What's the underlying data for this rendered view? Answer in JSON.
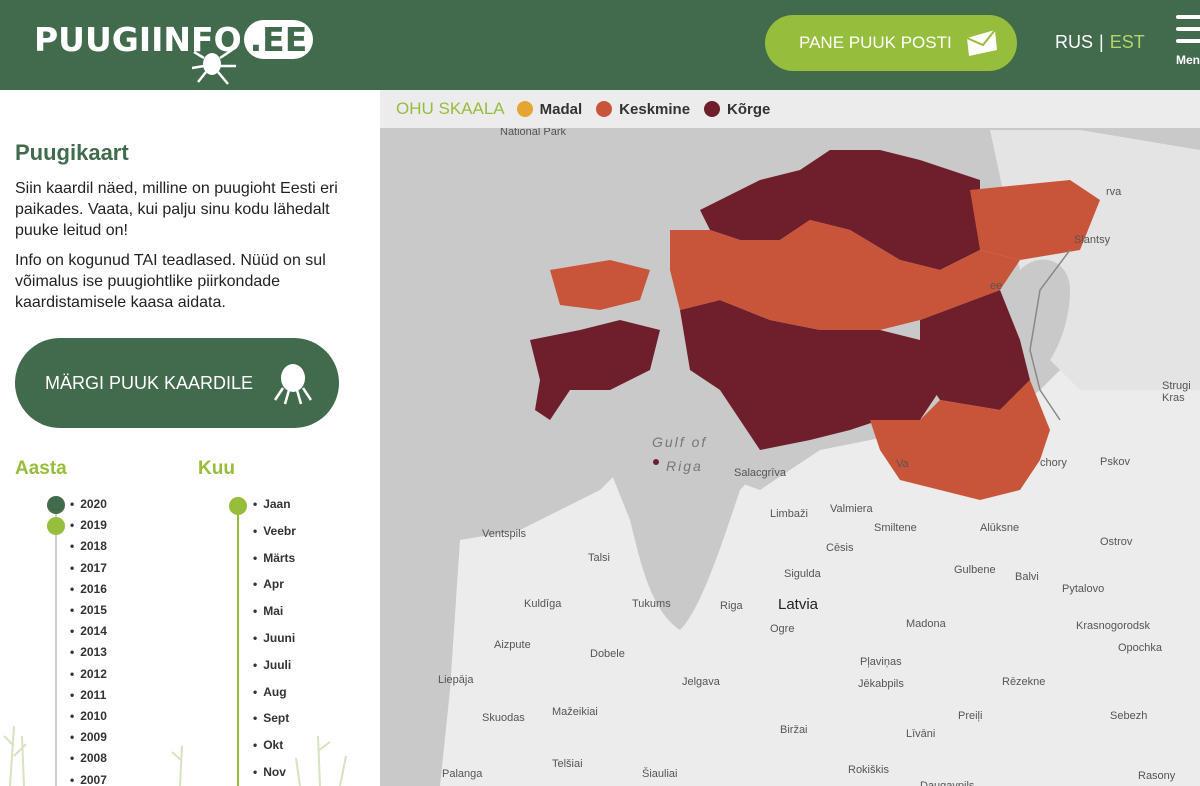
{
  "header": {
    "logo_text": "PUUGIINFO",
    "logo_ee": ".EE",
    "post_button": "PANE PUUK POSTI",
    "lang_rus": "RUS",
    "lang_sep": "|",
    "lang_est": "EST",
    "menu_label": "Menu"
  },
  "sidebar": {
    "title": "Puugikaart",
    "description_1": "Siin kaardil näed, milline on puugioht Eesti eri paikades. Vaata, kui palju sinu kodu lähedalt puuke leitud on!",
    "description_2": "Info on kogunud TAI teadlased. Nüüd on sul võimalus ise puugiohtlike piirkondade kaardistamisele kaasa aidata.",
    "mark_button": "MÄRGI PUUK KAARDILE",
    "year_title": "Aasta",
    "month_title": "Kuu",
    "years": [
      "2020",
      "2019",
      "2018",
      "2017",
      "2016",
      "2015",
      "2014",
      "2013",
      "2012",
      "2011",
      "2010",
      "2009",
      "2008",
      "2007"
    ],
    "selected_year_dark": "2020",
    "selected_year_light": "2019",
    "months": [
      "Jaan",
      "Veebr",
      "Märts",
      "Apr",
      "Mai",
      "Juuni",
      "Juuli",
      "Aug",
      "Sept",
      "Okt",
      "Nov"
    ],
    "selected_month": "Jaan"
  },
  "legend": {
    "title": "OHU SKAALA",
    "items": [
      {
        "label": "Madal",
        "color": "#e5a534"
      },
      {
        "label": "Keskmine",
        "color": "#c8553a"
      },
      {
        "label": "Kõrge",
        "color": "#6e1f2b"
      }
    ]
  },
  "map": {
    "labels": {
      "national_park": "National Park",
      "narva": "rva",
      "slantsy": "Slantsy",
      "ee": "ee",
      "strugi": "Strugi Kras",
      "gulf1": "Gulf of",
      "gulf2": "Riga",
      "salacgriva": "Salacgrīva",
      "chory": "chory",
      "pskov": "Pskov",
      "ventspils": "Ventspils",
      "limbazi": "Limbaži",
      "valmiera": "Valmiera",
      "smiltene": "Smiltene",
      "aluksne": "Alūksne",
      "ostrov": "Ostrov",
      "talsi": "Talsi",
      "cesis": "Cēsis",
      "gulbene": "Gulbene",
      "balvi": "Balvi",
      "pytalovo": "Pytalovo",
      "sigulda": "Sigulda",
      "kuldiga": "Kuldīga",
      "tukums": "Tukums",
      "riga": "Riga",
      "latvia": "Latvia",
      "ogre": "Ogre",
      "krasnogorodsk": "Krasnogorodsk",
      "aizpute": "Aizpute",
      "dobele": "Dobele",
      "madona": "Madona",
      "opochka": "Opochka",
      "jelgava": "Jelgava",
      "liepaja": "Liepāja",
      "plavinas": "Pļaviņas",
      "jekabpils": "Jēkabpils",
      "rezekne": "Rēzekne",
      "skuodas": "Skuodas",
      "mazeikiai": "Mažeikiai",
      "livani": "Līvāni",
      "preili": "Preiļi",
      "sebezh": "Sebezh",
      "birzai": "Biržai",
      "telsiai": "Telšiai",
      "palanga": "Palanga",
      "siauliai": "Šiauliai",
      "rokiskis": "Rokiškis",
      "daugavpils": "Daugavpils",
      "rasony": "Rasony",
      "va": "Va"
    }
  }
}
